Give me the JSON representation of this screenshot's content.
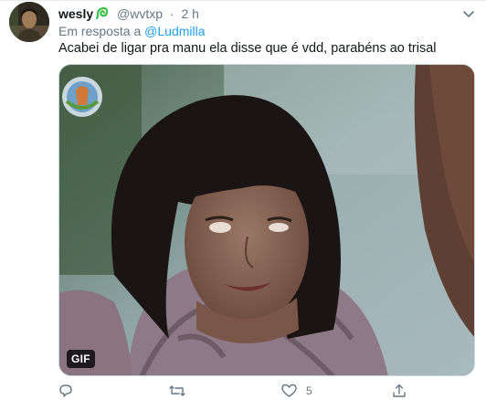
{
  "tweet": {
    "author": {
      "display_name": "wesly",
      "name_emoji": "green-swirl-icon",
      "handle": "@wvtxp",
      "separator": "·",
      "timestamp": "2 h"
    },
    "reply": {
      "prefix": "Em resposta a",
      "mention": "@Ludmilla"
    },
    "text": "Acabei de ligar pra manu ela disse que é vdd, parabéns ao trisal",
    "media": {
      "type": "gif",
      "badge": "GIF"
    },
    "actions": {
      "reply": {
        "icon": "reply-icon",
        "count": ""
      },
      "retweet": {
        "icon": "retweet-icon",
        "count": ""
      },
      "like": {
        "icon": "heart-icon",
        "count": "5"
      },
      "share": {
        "icon": "share-icon",
        "count": ""
      }
    }
  },
  "colors": {
    "accent": "#1da1f2",
    "secondary_text": "#657786",
    "primary_text": "#14171a",
    "border": "#e6ecf0"
  }
}
